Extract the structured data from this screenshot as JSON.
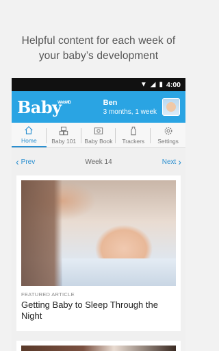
{
  "promo": {
    "line1": "Helpful content for each week of",
    "line2": "your baby’s development"
  },
  "statusbar": {
    "time": "4:00"
  },
  "appbar": {
    "logo": "Baby",
    "logo_sup": "WebMD",
    "name": "Ben",
    "age": "3 months, 1 week"
  },
  "tabs": [
    {
      "label": "Home",
      "icon": "home-icon",
      "active": true
    },
    {
      "label": "Baby 101",
      "icon": "blocks-icon"
    },
    {
      "label": "Baby Book",
      "icon": "photo-icon"
    },
    {
      "label": "Trackers",
      "icon": "bottle-icon"
    },
    {
      "label": "Settings",
      "icon": "gear-icon"
    }
  ],
  "weeknav": {
    "prev": "Prev",
    "week": "Week 14",
    "next": "Next"
  },
  "article": {
    "kicker": "FEATURED ARTICLE",
    "title": "Getting Baby to Sleep Through the Night"
  },
  "colors": {
    "accent": "#2aa4e3",
    "link": "#2a8fd0"
  }
}
